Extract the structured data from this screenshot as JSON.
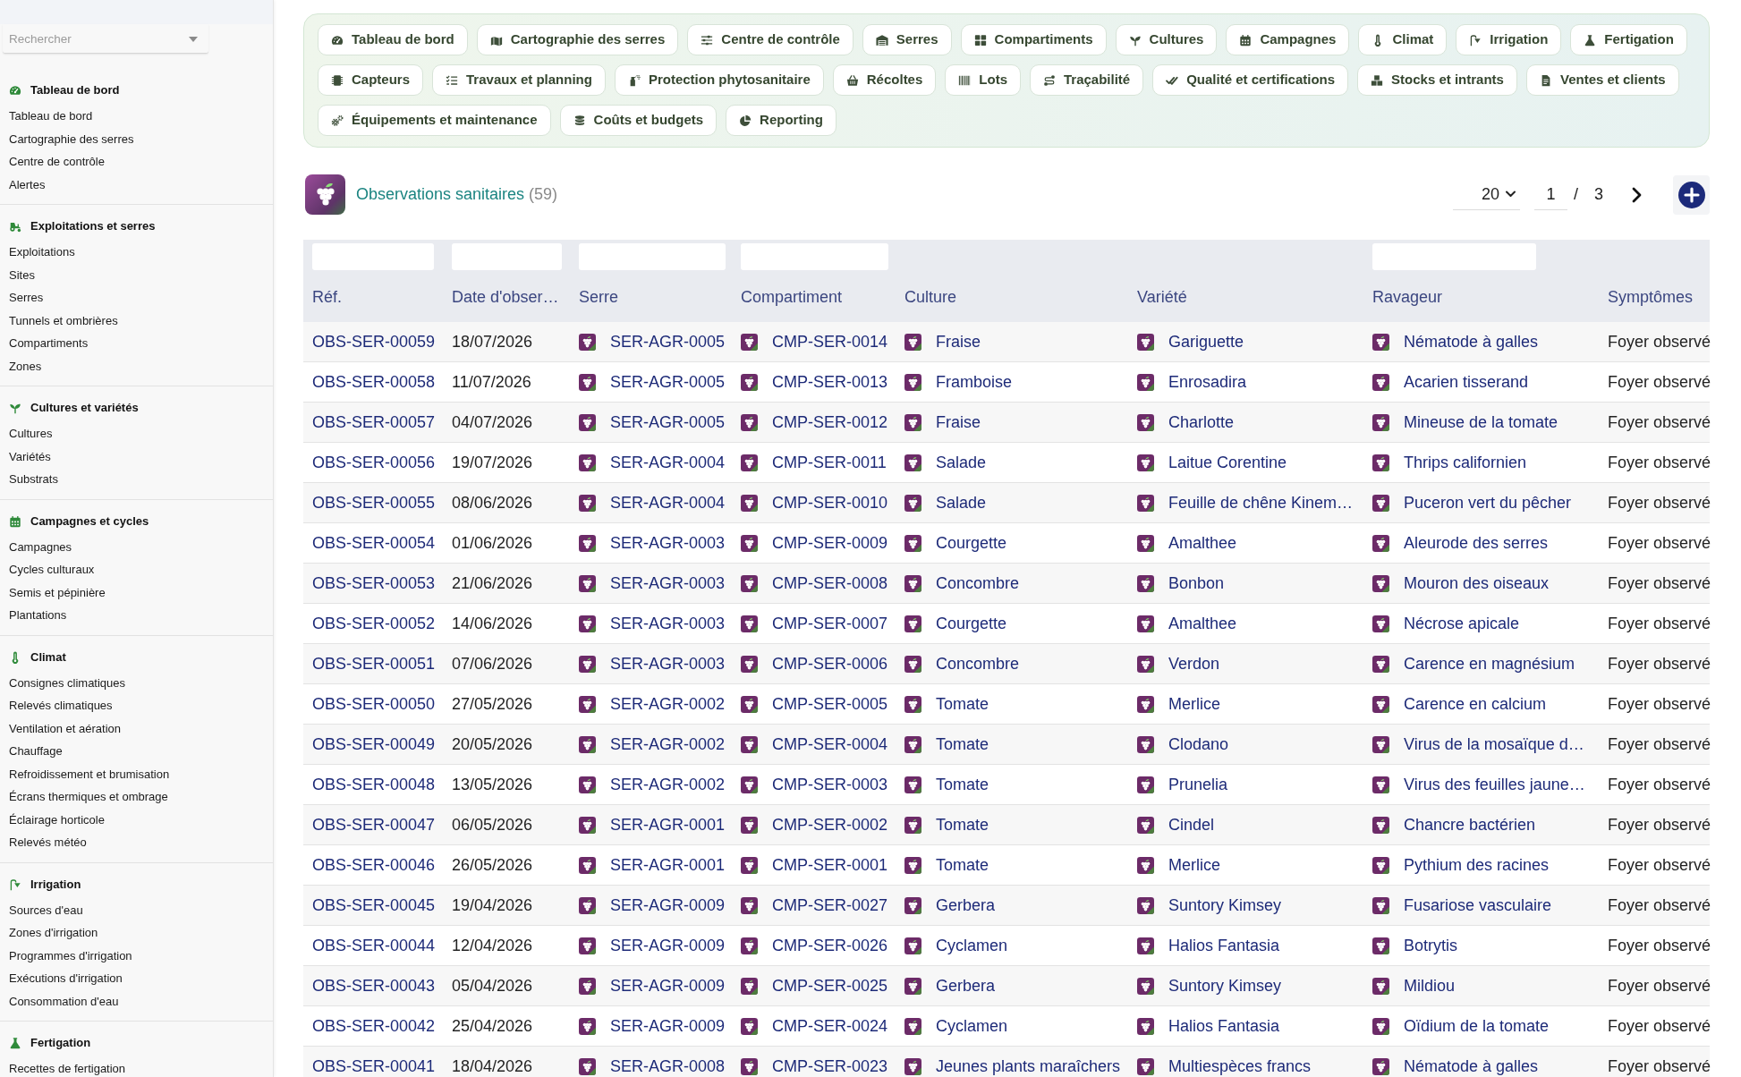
{
  "sidebar": {
    "search": {
      "placeholder": "Rechercher"
    },
    "sections": [
      {
        "title": "Tableau de bord",
        "items": [
          "Tableau de bord",
          "Cartographie des serres",
          "Centre de contrôle",
          "Alertes"
        ]
      },
      {
        "title": "Exploitations et serres",
        "items": [
          "Exploitations",
          "Sites",
          "Serres",
          "Tunnels et ombrières",
          "Compartiments",
          "Zones"
        ]
      },
      {
        "title": "Cultures et variétés",
        "items": [
          "Cultures",
          "Variétés",
          "Substrats"
        ]
      },
      {
        "title": "Campagnes et cycles",
        "items": [
          "Campagnes",
          "Cycles culturaux",
          "Semis et pépinière",
          "Plantations"
        ]
      },
      {
        "title": "Climat",
        "items": [
          "Consignes climatiques",
          "Relevés climatiques",
          "Ventilation et aération",
          "Chauffage",
          "Refroidissement et brumisation",
          "Écrans thermiques et ombrage",
          "Éclairage horticole",
          "Relevés météo"
        ]
      },
      {
        "title": "Irrigation",
        "items": [
          "Sources d'eau",
          "Zones d'irrigation",
          "Programmes d'irrigation",
          "Exécutions d'irrigation",
          "Consommation d'eau"
        ]
      },
      {
        "title": "Fertigation",
        "items": [
          "Recettes de fertigation"
        ]
      }
    ]
  },
  "nav": {
    "buttons": [
      "Tableau de bord",
      "Cartographie des serres",
      "Centre de contrôle",
      "Serres",
      "Compartiments",
      "Cultures",
      "Campagnes",
      "Climat",
      "Irrigation",
      "Fertigation",
      "Capteurs",
      "Travaux et planning",
      "Protection phytosanitaire",
      "Récoltes",
      "Lots",
      "Traçabilité",
      "Qualité et certifications",
      "Stocks et intrants",
      "Ventes et clients",
      "Équipements et maintenance",
      "Coûts et budgets",
      "Reporting"
    ]
  },
  "header": {
    "title": "Observations sanitaires",
    "count": "(59)"
  },
  "pagination": {
    "page_size": "20",
    "page": "1",
    "separator": "/",
    "page_count": "3"
  },
  "table": {
    "columns": [
      {
        "label": "Réf.",
        "kind": "link",
        "filter": true
      },
      {
        "label": "Date d'obser…",
        "kind": "text",
        "filter": true
      },
      {
        "label": "Serre",
        "kind": "record",
        "filter": true
      },
      {
        "label": "Compartiment",
        "kind": "record",
        "filter": true
      },
      {
        "label": "Culture",
        "kind": "record",
        "filter": false
      },
      {
        "label": "Variété",
        "kind": "record",
        "filter": false
      },
      {
        "label": "Ravageur",
        "kind": "record",
        "filter": true
      },
      {
        "label": "Symptômes",
        "kind": "text",
        "filter": false
      }
    ],
    "rows": [
      [
        "OBS-SER-00059",
        "18/07/2026",
        "SER-AGR-0005",
        "CMP-SER-0014",
        "Fraise",
        "Gariguette",
        "Nématode à galles",
        "Foyer observé"
      ],
      [
        "OBS-SER-00058",
        "11/07/2026",
        "SER-AGR-0005",
        "CMP-SER-0013",
        "Framboise",
        "Enrosadira",
        "Acarien tisserand",
        "Foyer observé"
      ],
      [
        "OBS-SER-00057",
        "04/07/2026",
        "SER-AGR-0005",
        "CMP-SER-0012",
        "Fraise",
        "Charlotte",
        "Mineuse de la tomate",
        "Foyer observé"
      ],
      [
        "OBS-SER-00056",
        "19/07/2026",
        "SER-AGR-0004",
        "CMP-SER-0011",
        "Salade",
        "Laitue Corentine",
        "Thrips californien",
        "Foyer observé"
      ],
      [
        "OBS-SER-00055",
        "08/06/2026",
        "SER-AGR-0004",
        "CMP-SER-0010",
        "Salade",
        "Feuille de chêne Kinem…",
        "Puceron vert du pêcher",
        "Foyer observé"
      ],
      [
        "OBS-SER-00054",
        "01/06/2026",
        "SER-AGR-0003",
        "CMP-SER-0009",
        "Courgette",
        "Amalthee",
        "Aleurode des serres",
        "Foyer observé"
      ],
      [
        "OBS-SER-00053",
        "21/06/2026",
        "SER-AGR-0003",
        "CMP-SER-0008",
        "Concombre",
        "Bonbon",
        "Mouron des oiseaux",
        "Foyer observé"
      ],
      [
        "OBS-SER-00052",
        "14/06/2026",
        "SER-AGR-0003",
        "CMP-SER-0007",
        "Courgette",
        "Amalthee",
        "Nécrose apicale",
        "Foyer observé"
      ],
      [
        "OBS-SER-00051",
        "07/06/2026",
        "SER-AGR-0003",
        "CMP-SER-0006",
        "Concombre",
        "Verdon",
        "Carence en magnésium",
        "Foyer observé"
      ],
      [
        "OBS-SER-00050",
        "27/05/2026",
        "SER-AGR-0002",
        "CMP-SER-0005",
        "Tomate",
        "Merlice",
        "Carence en calcium",
        "Foyer observé"
      ],
      [
        "OBS-SER-00049",
        "20/05/2026",
        "SER-AGR-0002",
        "CMP-SER-0004",
        "Tomate",
        "Clodano",
        "Virus de la mosaïque d…",
        "Foyer observé"
      ],
      [
        "OBS-SER-00048",
        "13/05/2026",
        "SER-AGR-0002",
        "CMP-SER-0003",
        "Tomate",
        "Prunelia",
        "Virus des feuilles jaune…",
        "Foyer observé"
      ],
      [
        "OBS-SER-00047",
        "06/05/2026",
        "SER-AGR-0001",
        "CMP-SER-0002",
        "Tomate",
        "Cindel",
        "Chancre bactérien",
        "Foyer observé"
      ],
      [
        "OBS-SER-00046",
        "26/05/2026",
        "SER-AGR-0001",
        "CMP-SER-0001",
        "Tomate",
        "Merlice",
        "Pythium des racines",
        "Foyer observé"
      ],
      [
        "OBS-SER-00045",
        "19/04/2026",
        "SER-AGR-0009",
        "CMP-SER-0027",
        "Gerbera",
        "Suntory Kimsey",
        "Fusariose vasculaire",
        "Foyer observé"
      ],
      [
        "OBS-SER-00044",
        "12/04/2026",
        "SER-AGR-0009",
        "CMP-SER-0026",
        "Cyclamen",
        "Halios Fantasia",
        "Botrytis",
        "Foyer observé"
      ],
      [
        "OBS-SER-00043",
        "05/04/2026",
        "SER-AGR-0009",
        "CMP-SER-0025",
        "Gerbera",
        "Suntory Kimsey",
        "Mildiou",
        "Foyer observé"
      ],
      [
        "OBS-SER-00042",
        "25/04/2026",
        "SER-AGR-0009",
        "CMP-SER-0024",
        "Cyclamen",
        "Halios Fantasia",
        "Oïdium de la tomate",
        "Foyer observé"
      ],
      [
        "OBS-SER-00041",
        "18/04/2026",
        "SER-AGR-0008",
        "CMP-SER-0023",
        "Jeunes plants maraîchers",
        "Multiespèces francs",
        "Nématode à galles",
        "Foyer observé"
      ]
    ]
  }
}
